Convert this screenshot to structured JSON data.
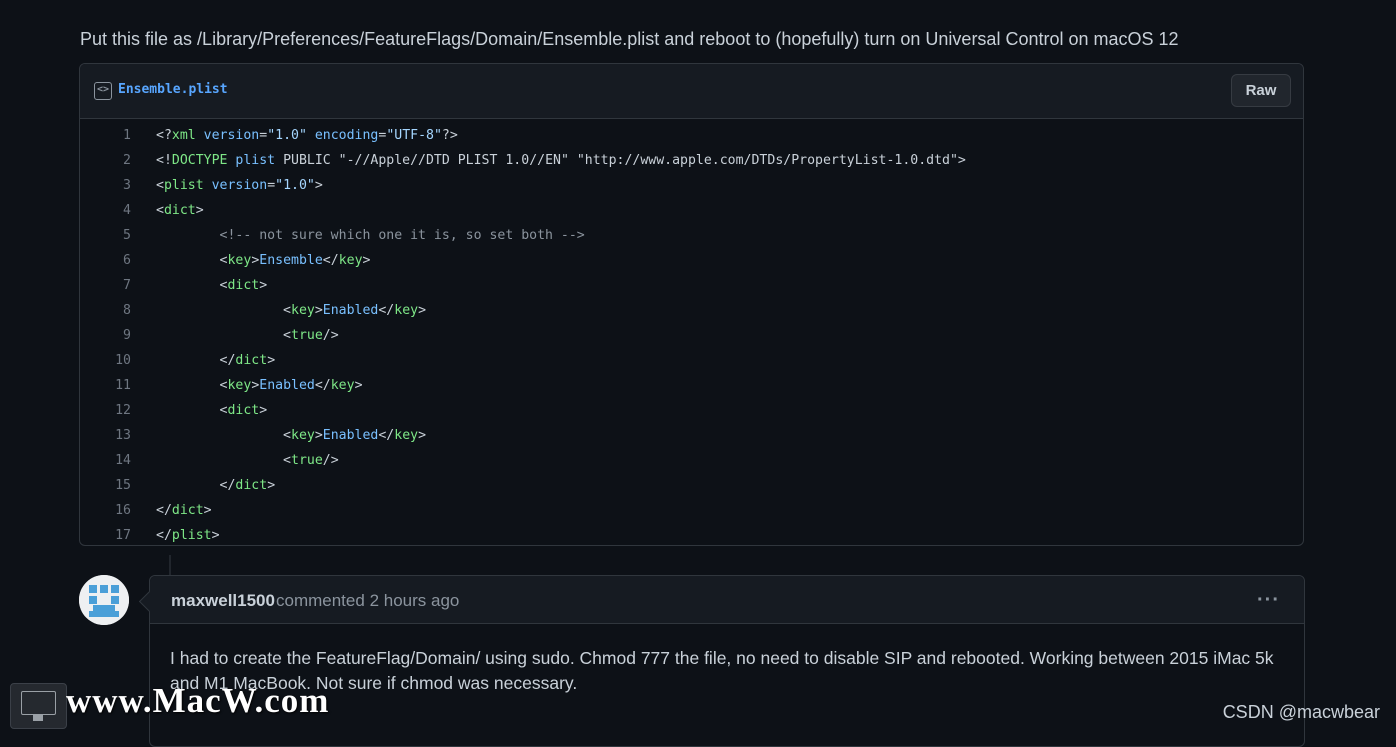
{
  "gist": {
    "description": "Put this file as /Library/Preferences/FeatureFlags/Domain/Ensemble.plist and reboot to (hopefully) turn on Universal Control on macOS 12",
    "file": {
      "icon": "code-square-icon",
      "icon_glyph": "<>",
      "name": "Ensemble.plist",
      "raw_label": "Raw"
    },
    "lines": [
      {
        "num": "1",
        "tokens": [
          {
            "t": "plain",
            "v": "<?"
          },
          {
            "t": "tag",
            "v": "xml"
          },
          {
            "t": "plain",
            "v": " "
          },
          {
            "t": "attr",
            "v": "version"
          },
          {
            "t": "plain",
            "v": "="
          },
          {
            "t": "str",
            "v": "\"1.0\""
          },
          {
            "t": "plain",
            "v": " "
          },
          {
            "t": "attr",
            "v": "encoding"
          },
          {
            "t": "plain",
            "v": "="
          },
          {
            "t": "str",
            "v": "\"UTF-8\""
          },
          {
            "t": "plain",
            "v": "?>"
          }
        ]
      },
      {
        "num": "2",
        "tokens": [
          {
            "t": "plain",
            "v": "<!"
          },
          {
            "t": "tag",
            "v": "DOCTYPE"
          },
          {
            "t": "plain",
            "v": " "
          },
          {
            "t": "attr",
            "v": "plist"
          },
          {
            "t": "plain",
            "v": " PUBLIC \"-//Apple//DTD PLIST 1.0//EN\" \"http://www.apple.com/DTDs/PropertyList-1.0.dtd\">"
          }
        ]
      },
      {
        "num": "3",
        "tokens": [
          {
            "t": "plain",
            "v": "<"
          },
          {
            "t": "tag",
            "v": "plist"
          },
          {
            "t": "plain",
            "v": " "
          },
          {
            "t": "attr",
            "v": "version"
          },
          {
            "t": "plain",
            "v": "="
          },
          {
            "t": "str",
            "v": "\"1.0\""
          },
          {
            "t": "plain",
            "v": ">"
          }
        ]
      },
      {
        "num": "4",
        "tokens": [
          {
            "t": "plain",
            "v": "<"
          },
          {
            "t": "tag",
            "v": "dict"
          },
          {
            "t": "plain",
            "v": ">"
          }
        ]
      },
      {
        "num": "5",
        "tokens": [
          {
            "t": "plain",
            "v": "\t"
          },
          {
            "t": "comment",
            "v": "<!-- not sure which one it is, so set both -->"
          }
        ]
      },
      {
        "num": "6",
        "tokens": [
          {
            "t": "plain",
            "v": "\t<"
          },
          {
            "t": "tag",
            "v": "key"
          },
          {
            "t": "plain",
            "v": ">"
          },
          {
            "t": "text",
            "v": "Ensemble"
          },
          {
            "t": "plain",
            "v": "</"
          },
          {
            "t": "tag",
            "v": "key"
          },
          {
            "t": "plain",
            "v": ">"
          }
        ]
      },
      {
        "num": "7",
        "tokens": [
          {
            "t": "plain",
            "v": "\t<"
          },
          {
            "t": "tag",
            "v": "dict"
          },
          {
            "t": "plain",
            "v": ">"
          }
        ]
      },
      {
        "num": "8",
        "tokens": [
          {
            "t": "plain",
            "v": "\t\t<"
          },
          {
            "t": "tag",
            "v": "key"
          },
          {
            "t": "plain",
            "v": ">"
          },
          {
            "t": "text",
            "v": "Enabled"
          },
          {
            "t": "plain",
            "v": "</"
          },
          {
            "t": "tag",
            "v": "key"
          },
          {
            "t": "plain",
            "v": ">"
          }
        ]
      },
      {
        "num": "9",
        "tokens": [
          {
            "t": "plain",
            "v": "\t\t<"
          },
          {
            "t": "tag",
            "v": "true"
          },
          {
            "t": "plain",
            "v": "/>"
          }
        ]
      },
      {
        "num": "10",
        "tokens": [
          {
            "t": "plain",
            "v": "\t</"
          },
          {
            "t": "tag",
            "v": "dict"
          },
          {
            "t": "plain",
            "v": ">"
          }
        ]
      },
      {
        "num": "11",
        "tokens": [
          {
            "t": "plain",
            "v": "\t<"
          },
          {
            "t": "tag",
            "v": "key"
          },
          {
            "t": "plain",
            "v": ">"
          },
          {
            "t": "text",
            "v": "Enabled"
          },
          {
            "t": "plain",
            "v": "</"
          },
          {
            "t": "tag",
            "v": "key"
          },
          {
            "t": "plain",
            "v": ">"
          }
        ]
      },
      {
        "num": "12",
        "tokens": [
          {
            "t": "plain",
            "v": "\t<"
          },
          {
            "t": "tag",
            "v": "dict"
          },
          {
            "t": "plain",
            "v": ">"
          }
        ]
      },
      {
        "num": "13",
        "tokens": [
          {
            "t": "plain",
            "v": "\t\t<"
          },
          {
            "t": "tag",
            "v": "key"
          },
          {
            "t": "plain",
            "v": ">"
          },
          {
            "t": "text",
            "v": "Enabled"
          },
          {
            "t": "plain",
            "v": "</"
          },
          {
            "t": "tag",
            "v": "key"
          },
          {
            "t": "plain",
            "v": ">"
          }
        ]
      },
      {
        "num": "14",
        "tokens": [
          {
            "t": "plain",
            "v": "\t\t<"
          },
          {
            "t": "tag",
            "v": "true"
          },
          {
            "t": "plain",
            "v": "/>"
          }
        ]
      },
      {
        "num": "15",
        "tokens": [
          {
            "t": "plain",
            "v": "\t</"
          },
          {
            "t": "tag",
            "v": "dict"
          },
          {
            "t": "plain",
            "v": ">"
          }
        ]
      },
      {
        "num": "16",
        "tokens": [
          {
            "t": "plain",
            "v": "</"
          },
          {
            "t": "tag",
            "v": "dict"
          },
          {
            "t": "plain",
            "v": ">"
          }
        ]
      },
      {
        "num": "17",
        "tokens": [
          {
            "t": "plain",
            "v": "</"
          },
          {
            "t": "tag",
            "v": "plist"
          },
          {
            "t": "plain",
            "v": ">"
          }
        ]
      }
    ]
  },
  "comment": {
    "avatar_icon": "identicon-avatar",
    "author": "maxwell1500",
    "verb": "commented",
    "time": "2 hours ago",
    "menu_icon": "kebab-horizontal-icon",
    "menu_glyph": "···",
    "body": "I had to create the FeatureFlag/Domain/ using sudo. Chmod 777 the file, no need to disable SIP and rebooted. Working between 2015 iMac 5k and M1 MacBook. Not sure if chmod was necessary."
  },
  "watermarks": {
    "site_text": "www.MacW.com",
    "logo_icon": "macw-monitor-logo",
    "csdn_text": "CSDN @macwbear"
  },
  "colors": {
    "background": "#0d1117",
    "header_bg": "#161b22",
    "border": "#30363d",
    "link": "#58a6ff",
    "tag": "#7ee787",
    "attr": "#79c0ff",
    "string": "#a5d6ff",
    "comment": "#8b949e"
  }
}
